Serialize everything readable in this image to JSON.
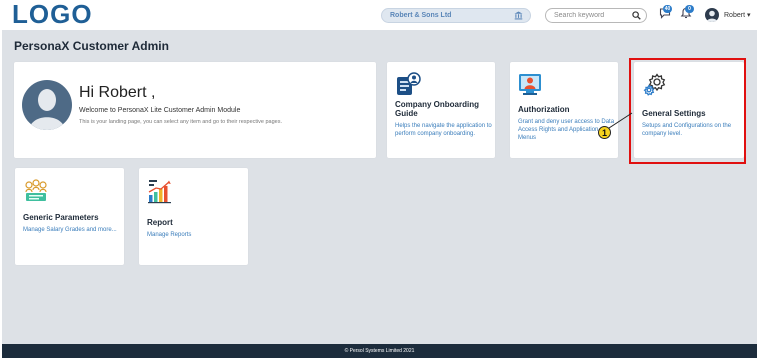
{
  "header": {
    "logo": "LOGO",
    "company_name": "Robert & Sons Ltd",
    "search_placeholder": "Search keyword",
    "messages_badge": "40",
    "notifications_badge": "0",
    "user_name": "Robert"
  },
  "page": {
    "title": "PersonaX Customer Admin"
  },
  "welcome": {
    "greeting": "Hi Robert ,",
    "line1": "Welcome to PersonaX Lite Customer Admin Module",
    "line2": "This is your landing page, you can select any item and go to their respective pages."
  },
  "tiles": [
    {
      "title": "Company Onboarding Guide",
      "description": "Helps the navigate the application to perform company onboarding.",
      "icon": "onboarding-guide-icon"
    },
    {
      "title": "Authorization",
      "description": "Grant and deny user access to Data Access Rights and Application Menus",
      "icon": "authorization-icon"
    },
    {
      "title": "General Settings",
      "description": "Setups and Configurations on the company level.",
      "icon": "gear-icon"
    },
    {
      "title": "Generic Parameters",
      "description": "Manage Salary Grades and more...",
      "icon": "generic-parameters-icon"
    },
    {
      "title": "Report",
      "description": "Manage Reports",
      "icon": "report-chart-icon"
    }
  ],
  "callout": {
    "number": "1"
  },
  "footer": {
    "text": "© Persol Systems Limited 2021"
  },
  "colors": {
    "accent": "#2c7cc9",
    "highlight": "#e01010",
    "footer": "#1c2c3c",
    "callout": "#f6d21e"
  }
}
